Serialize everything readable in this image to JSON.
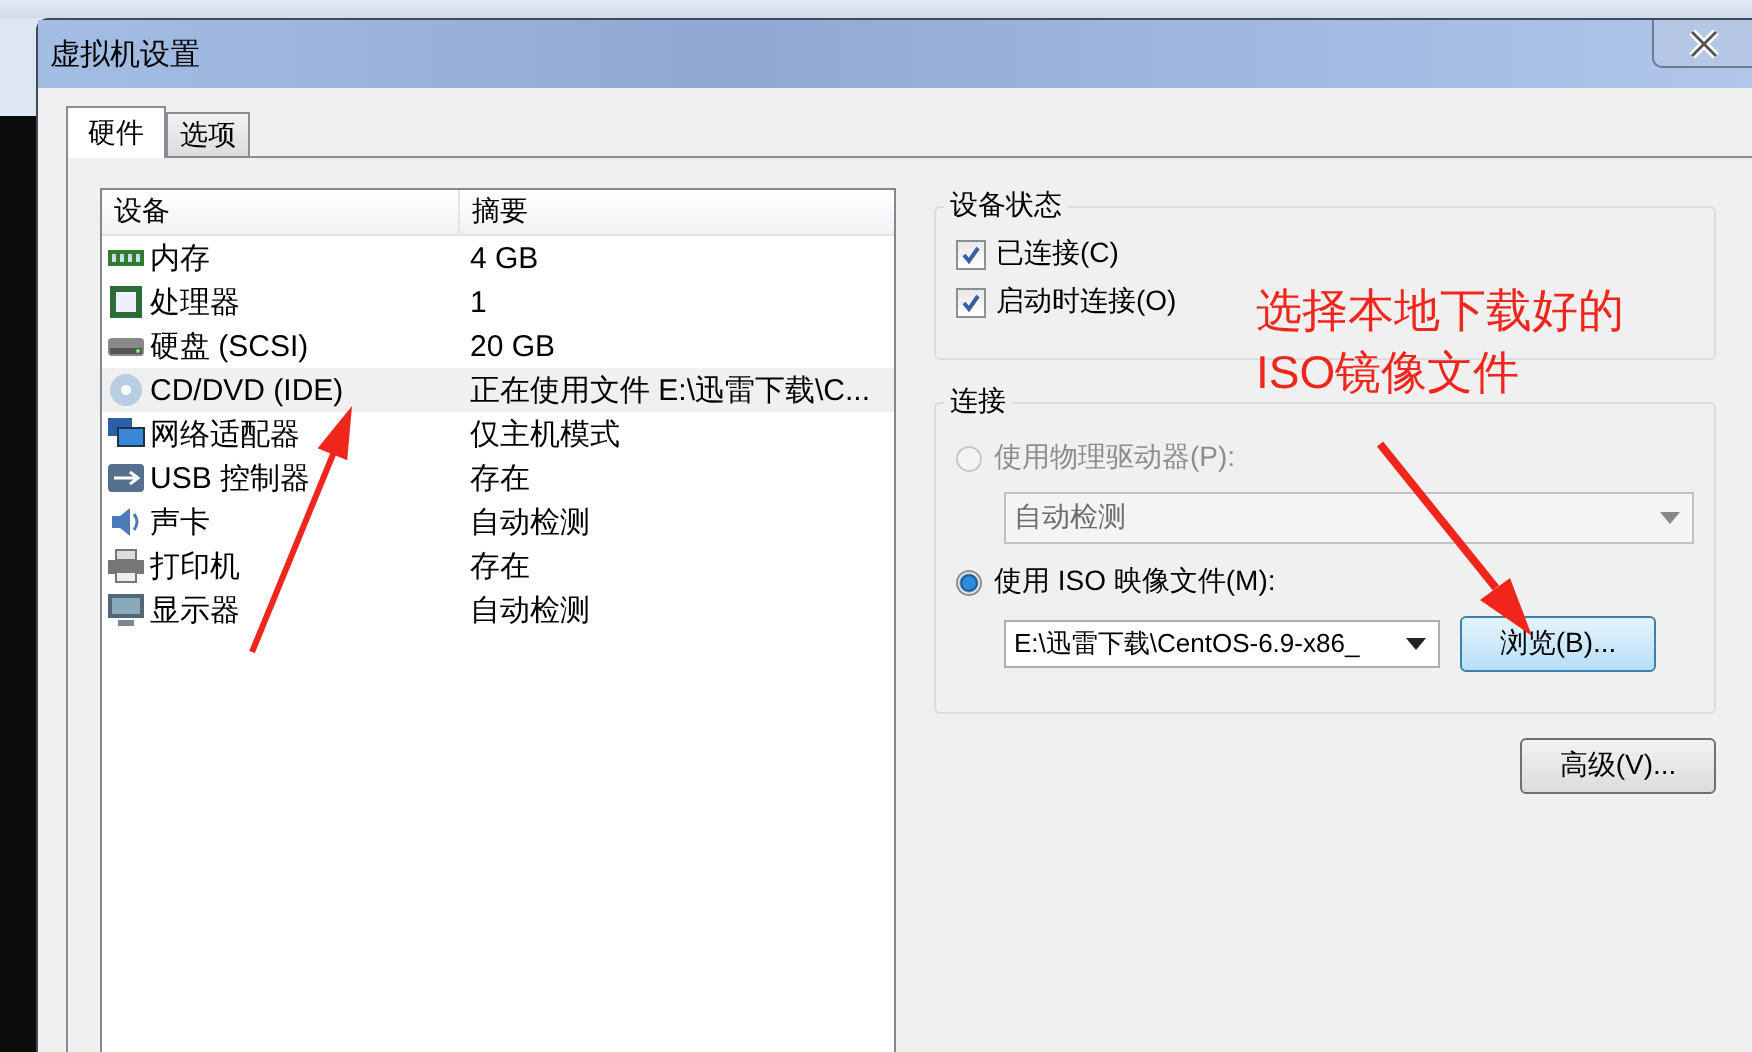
{
  "window": {
    "title": "虚拟机设置"
  },
  "tabs": [
    {
      "label": "硬件",
      "selected": true
    },
    {
      "label": "选项",
      "selected": false
    }
  ],
  "device_list": {
    "columns": [
      "设备",
      "摘要"
    ],
    "rows": [
      {
        "device": "内存",
        "summary": "4 GB",
        "selected": false
      },
      {
        "device": "处理器",
        "summary": "1",
        "selected": false
      },
      {
        "device": "硬盘 (SCSI)",
        "summary": "20 GB",
        "selected": false
      },
      {
        "device": "CD/DVD (IDE)",
        "summary": "正在使用文件 E:\\迅雷下载\\C...",
        "selected": true
      },
      {
        "device": "网络适配器",
        "summary": "仅主机模式",
        "selected": false
      },
      {
        "device": "USB 控制器",
        "summary": "存在",
        "selected": false
      },
      {
        "device": "声卡",
        "summary": "自动检测",
        "selected": false
      },
      {
        "device": "打印机",
        "summary": "存在",
        "selected": false
      },
      {
        "device": "显示器",
        "summary": "自动检测",
        "selected": false
      }
    ]
  },
  "device_status": {
    "title": "设备状态",
    "options": [
      {
        "label": "已连接(C)",
        "checked": true
      },
      {
        "label": "启动时连接(O)",
        "checked": true
      }
    ]
  },
  "connection": {
    "title": "连接",
    "physical": {
      "label": "使用物理驱动器(P):",
      "selected": false,
      "disabled": true,
      "dropdown": "自动检测"
    },
    "iso": {
      "label": "使用 ISO 映像文件(M):",
      "selected": true,
      "path": "E:\\迅雷下载\\CentOS-6.9-x86_",
      "browse": "浏览(B)..."
    }
  },
  "advanced_button": "高级(V)...",
  "annotation": "选择本地下载好的\nISO镜像文件"
}
